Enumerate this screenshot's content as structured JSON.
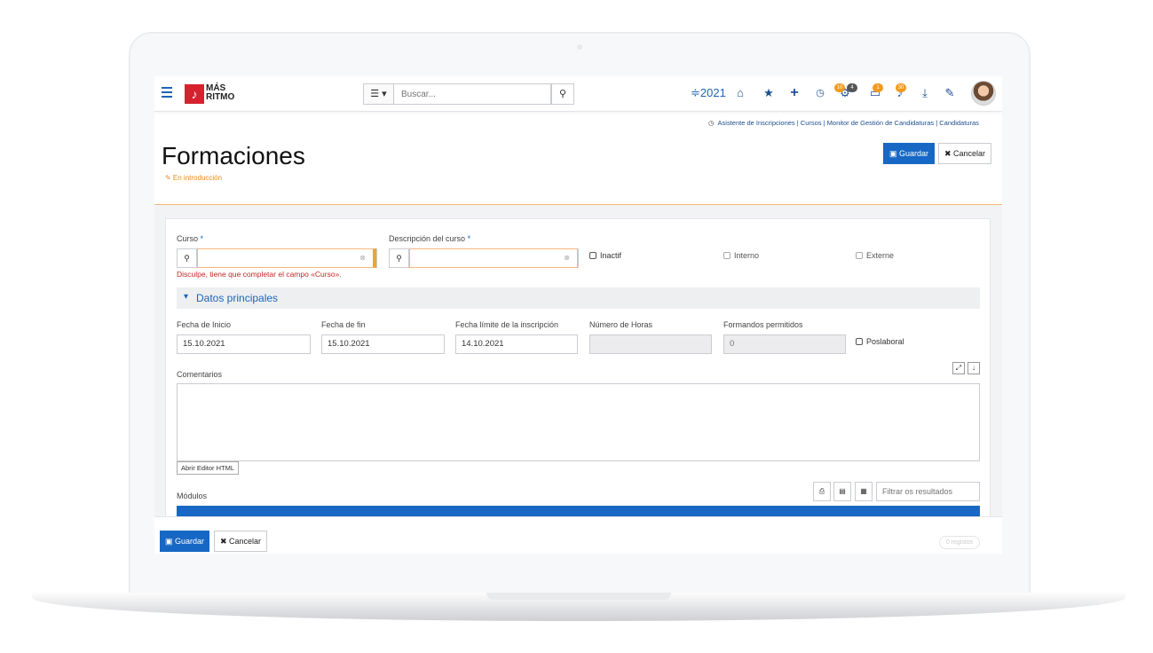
{
  "topbar": {
    "logo_line1": "MÁS",
    "logo_line2": "RITMO",
    "view_icon": "☰ ▾",
    "search_placeholder": "Buscar...",
    "year": "≑2021",
    "notif_badge_1": "10",
    "notif_badge_2": "4",
    "notif_badge_3": "1",
    "notif_badge_4": "30"
  },
  "breadcrumb": "Asistente de Inscripciones | Cursos | Monitor de Gestión de Candidaturas | Candidaturas",
  "page": {
    "title": "Formaciones",
    "status": "✎ En introducción",
    "save_label": "Guardar",
    "cancel_label": "Cancelar"
  },
  "form": {
    "curso_label": "Curso",
    "descripcion_label": "Descripción del curso",
    "required_mark": "*",
    "error": "Disculpe, tiene que completar el campo «Curso».",
    "inactif_label": "Inactif",
    "interno_label": "Interno",
    "externo_label": "Externe",
    "section_title": "Datos principales",
    "fecha_inicio_label": "Fecha de Inicio",
    "fecha_inicio_value": "15.10.2021",
    "fecha_fin_label": "Fecha de fin",
    "fecha_fin_value": "15.10.2021",
    "fecha_limite_label": "Fecha límite de la inscripción",
    "fecha_limite_value": "14.10.2021",
    "horas_label": "Número de Horas",
    "horas_value": "",
    "formandos_label": "Formandos permitidos",
    "formandos_value": "0",
    "postlaboral_label": "Poslaboral",
    "comentarios_label": "Comentarios",
    "html_editor_label": "Abrir Editor HTML",
    "modulos_label": "Módulos",
    "filter_placeholder": "Filtrar os resultados"
  },
  "footer": {
    "save_label": "Guardar",
    "cancel_label": "Cancelar",
    "results_pill": "0 registos"
  },
  "colors": {
    "primary": "#1768c4",
    "accent": "#f0a32e",
    "error": "#c62828",
    "brand": "#d6212f"
  }
}
